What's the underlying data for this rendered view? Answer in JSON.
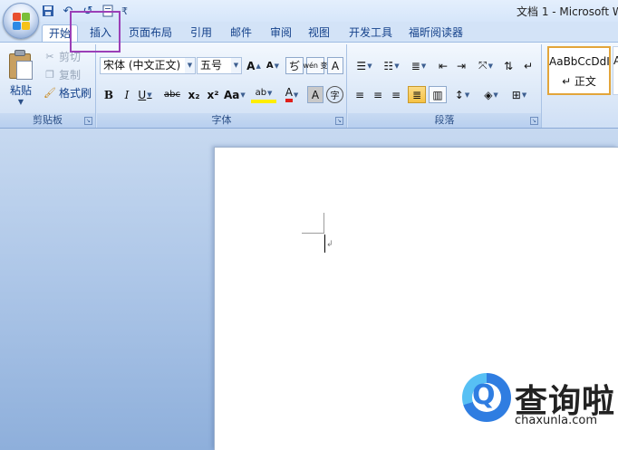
{
  "window": {
    "title": "文档 1 - Microsoft W"
  },
  "quick_access": {
    "save_icon": "save-icon",
    "undo_icon": "undo-icon",
    "redo_icon": "redo-icon",
    "customize_icon": "customize-qat-icon"
  },
  "tabs": [
    {
      "label": "开始",
      "active": true
    },
    {
      "label": "插入",
      "active": false
    },
    {
      "label": "页面布局",
      "active": false
    },
    {
      "label": "引用",
      "active": false
    },
    {
      "label": "邮件",
      "active": false
    },
    {
      "label": "审阅",
      "active": false
    },
    {
      "label": "视图",
      "active": false
    },
    {
      "label": "开发工具",
      "active": false
    },
    {
      "label": "福昕阅读器",
      "active": false
    }
  ],
  "ribbon": {
    "clipboard": {
      "label": "剪贴板",
      "paste": "粘贴",
      "cut": "剪切",
      "copy": "复制",
      "format_painter": "格式刷"
    },
    "font": {
      "label": "字体",
      "font_name": "宋体 (中文正文)",
      "font_size": "五号",
      "grow": "A",
      "shrink": "A",
      "clear": "ぢ",
      "phonetic": "wén 变",
      "border_char": "A",
      "bold": "B",
      "italic": "I",
      "underline": "U",
      "strike": "abc",
      "subscript": "x₂",
      "superscript": "x²",
      "change_case": "Aa",
      "highlight": "ab",
      "font_color": "A",
      "shade_char": "A",
      "enclose_char": "字"
    },
    "paragraph": {
      "label": "段落"
    },
    "styles": {
      "sample": "AaBbCcDdI",
      "normal": "↵ 正文",
      "next_sample": "A"
    }
  },
  "watermark": {
    "title": "查询啦",
    "url": "chaxunla.com",
    "logo_letter": "Q"
  },
  "colors": {
    "accent_highlight": "#9b3fb7",
    "ribbon_text": "#15428b",
    "style_selected_border": "#e3a53a",
    "workspace_blue": "#aec7e8"
  }
}
